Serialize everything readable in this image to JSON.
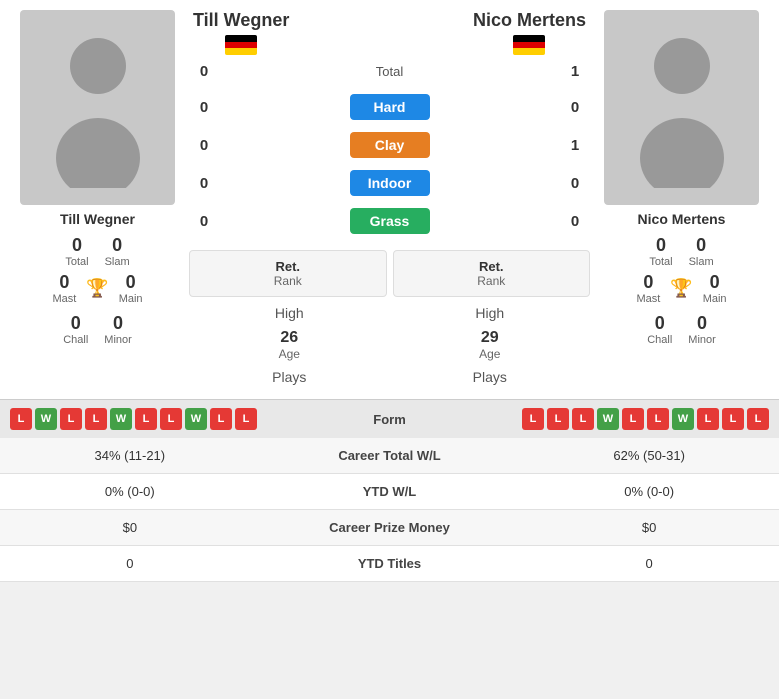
{
  "player1": {
    "name": "Till Wegner",
    "rank_label": "Ret.",
    "rank_sub": "Rank",
    "total": "0",
    "slam": "0",
    "mast": "0",
    "main": "0",
    "chall": "0",
    "minor": "0",
    "high": "High",
    "age": "26",
    "age_label": "Age",
    "plays_label": "Plays"
  },
  "player2": {
    "name": "Nico Mertens",
    "rank_label": "Ret.",
    "rank_sub": "Rank",
    "total": "0",
    "slam": "0",
    "mast": "0",
    "main": "0",
    "chall": "0",
    "minor": "0",
    "high": "High",
    "age": "29",
    "age_label": "Age",
    "plays_label": "Plays"
  },
  "match": {
    "total_label": "Total",
    "total_score_left": "0",
    "total_score_right": "1",
    "hard_left": "0",
    "hard_right": "0",
    "clay_left": "0",
    "clay_right": "1",
    "indoor_left": "0",
    "indoor_right": "0",
    "grass_left": "0",
    "grass_right": "0"
  },
  "form": {
    "label": "Form",
    "player1_form": [
      "L",
      "W",
      "L",
      "L",
      "W",
      "L",
      "L",
      "W",
      "L",
      "L"
    ],
    "player2_form": [
      "L",
      "L",
      "L",
      "W",
      "L",
      "L",
      "W",
      "L",
      "L",
      "L"
    ]
  },
  "stats": [
    {
      "left": "34% (11-21)",
      "center": "Career Total W/L",
      "right": "62% (50-31)"
    },
    {
      "left": "0% (0-0)",
      "center": "YTD W/L",
      "right": "0% (0-0)"
    },
    {
      "left": "$0",
      "center": "Career Prize Money",
      "right": "$0"
    },
    {
      "left": "0",
      "center": "YTD Titles",
      "right": "0"
    }
  ],
  "labels": {
    "total": "Total",
    "slam": "Slam",
    "mast": "Mast",
    "main": "Main",
    "chall": "Chall",
    "minor": "Minor"
  }
}
